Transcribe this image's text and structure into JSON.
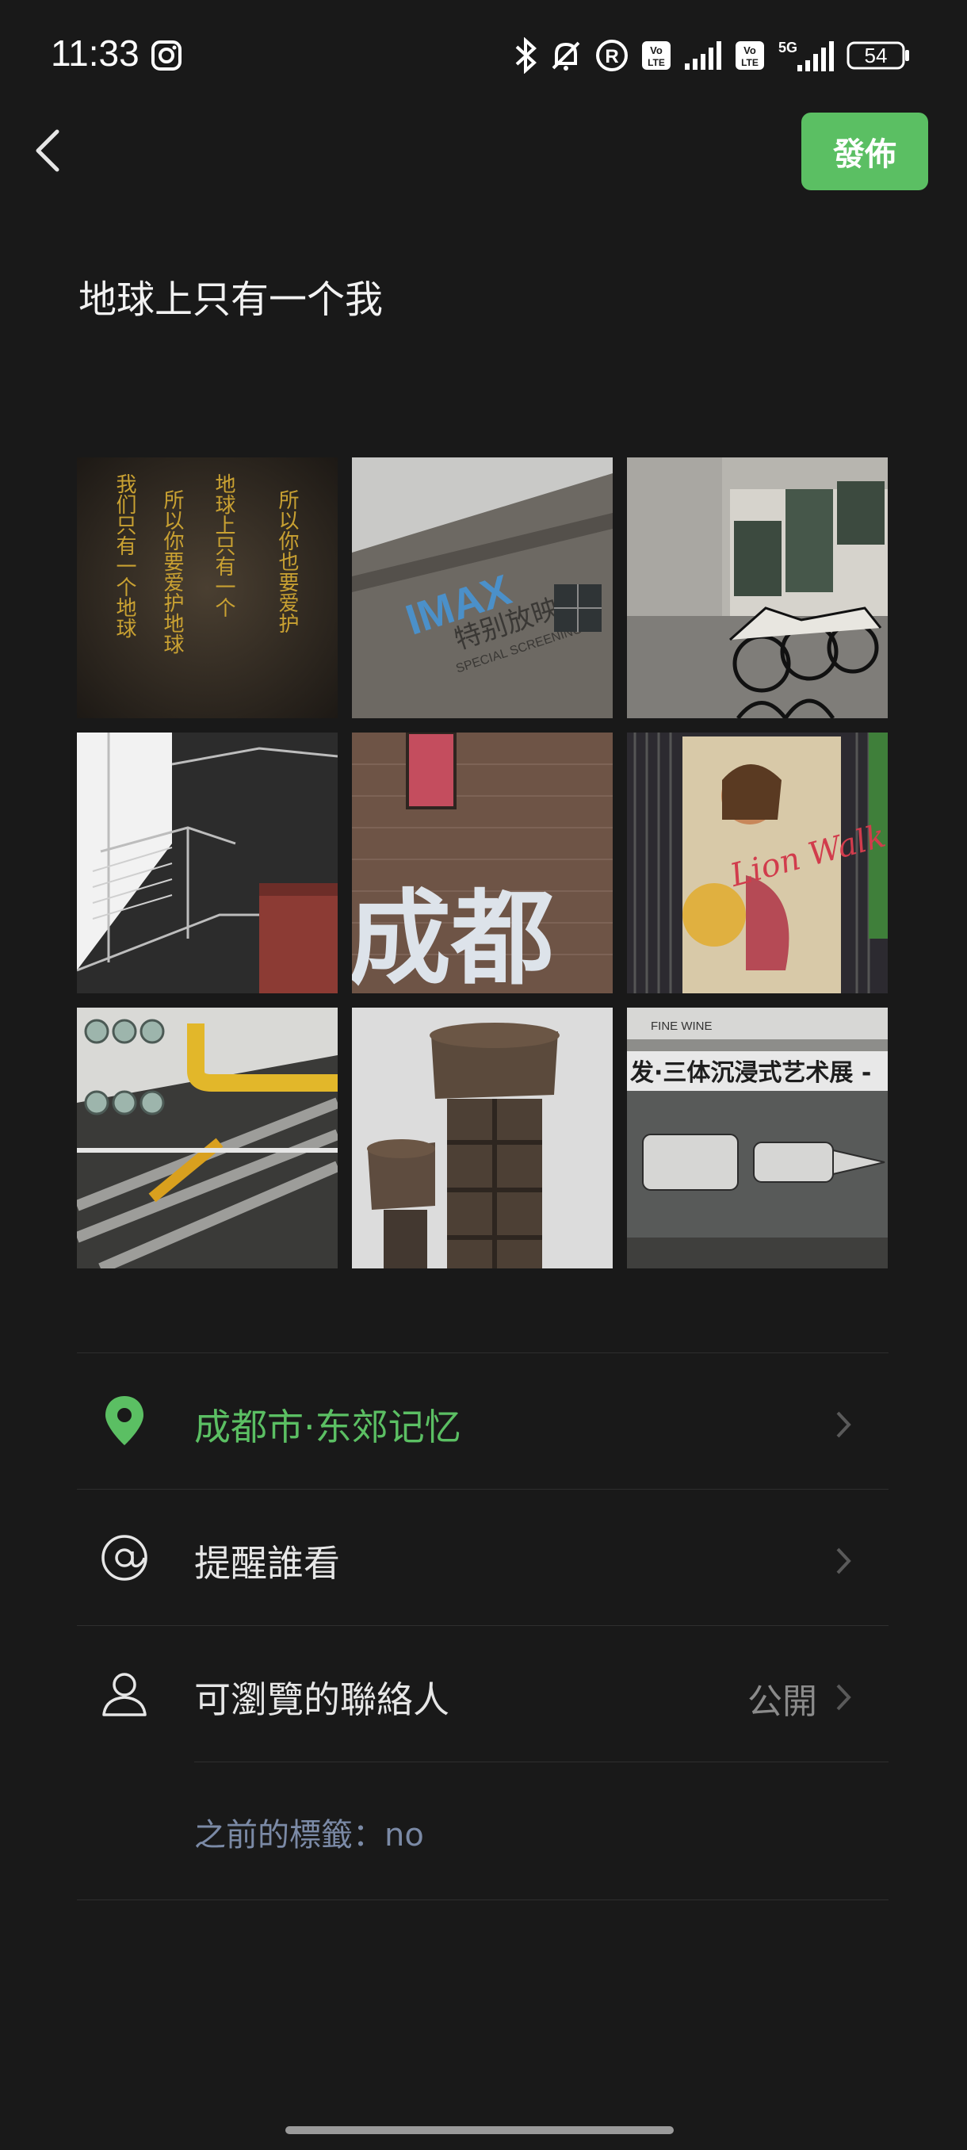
{
  "status_bar": {
    "time": "11:33",
    "battery": "54",
    "network": "5G"
  },
  "header": {
    "back_icon": "chevron-left-icon",
    "publish_label": "發佈"
  },
  "post": {
    "text": "地球上只有一个我"
  },
  "photos": [
    {
      "name": "photo-calligraphy-wall",
      "texts": [
        "所以你也要爱护",
        "地球上只有一个",
        "所以你要爱护地球",
        "我们只有一个地球"
      ]
    },
    {
      "name": "photo-imax-facade",
      "texts": [
        "IMAX",
        "特别放映",
        "SPECIAL SCREENING"
      ]
    },
    {
      "name": "photo-building-mural"
    },
    {
      "name": "photo-stairs-tank"
    },
    {
      "name": "photo-brick-wall-chengdu",
      "texts": [
        "成都"
      ]
    },
    {
      "name": "photo-poster-lion-walk",
      "texts": [
        "Lion Walk"
      ]
    },
    {
      "name": "photo-industrial-pipes"
    },
    {
      "name": "photo-water-tower"
    },
    {
      "name": "photo-exhibition-sign",
      "texts": [
        "FINE WINE",
        "发·三体沉浸式艺术展 -"
      ]
    }
  ],
  "options": {
    "location": {
      "label": "成都市·东郊记忆",
      "icon": "location-pin-icon"
    },
    "mention": {
      "label": "提醒誰看",
      "icon": "at-sign-icon"
    },
    "visibility": {
      "label": "可瀏覽的聯絡人",
      "value": "公開",
      "icon": "user-icon"
    },
    "previous_tags": "之前的標籤：no"
  },
  "colors": {
    "background": "#191919",
    "accent": "#5bbf63",
    "note": "#7b8aa6"
  }
}
